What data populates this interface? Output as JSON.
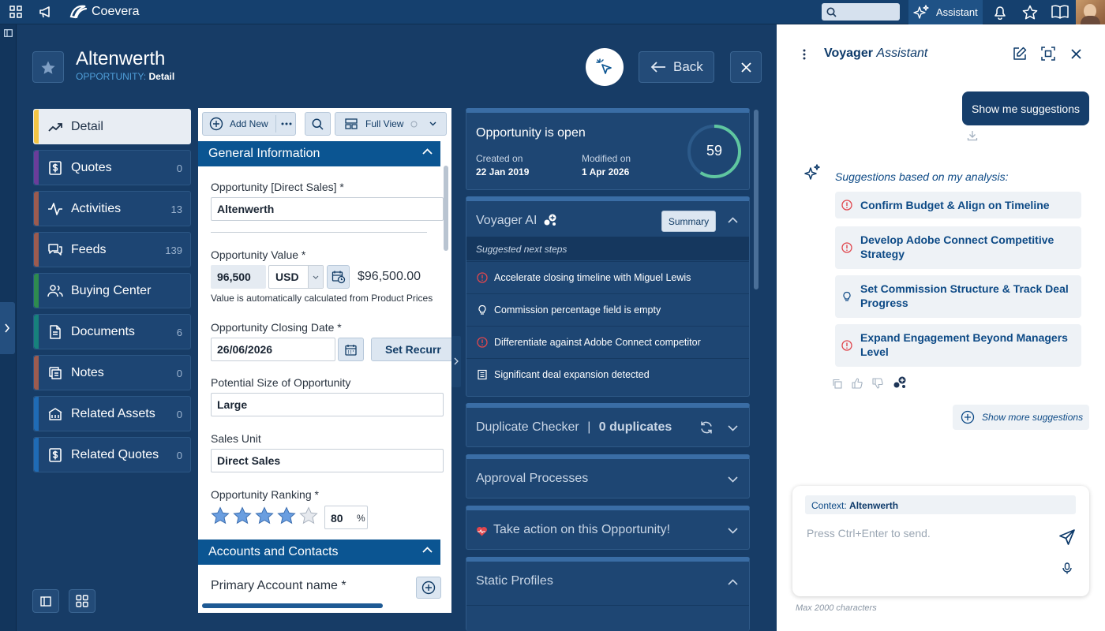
{
  "topbar": {
    "brand": "Coevera",
    "assistant_label": "Assistant",
    "search_placeholder": ""
  },
  "header": {
    "title": "Altenwerth",
    "breadcrumb_entity": "OPPORTUNITY:",
    "breadcrumb_view": "Detail",
    "back_label": "Back"
  },
  "nav": {
    "items": [
      {
        "label": "Detail",
        "count": "",
        "color": "#f3c545"
      },
      {
        "label": "Quotes",
        "count": "0",
        "color": "#6a3d9a"
      },
      {
        "label": "Activities",
        "count": "13",
        "color": "#9c5b4f"
      },
      {
        "label": "Feeds",
        "count": "139",
        "color": "#9c5b4f"
      },
      {
        "label": "Buying Center",
        "count": "",
        "color": "#2e8b4f"
      },
      {
        "label": "Documents",
        "count": "6",
        "color": "#17817c"
      },
      {
        "label": "Notes",
        "count": "0",
        "color": "#9c5b4f"
      },
      {
        "label": "Related Assets",
        "count": "0",
        "color": "#1f6bb5"
      },
      {
        "label": "Related Quotes",
        "count": "0",
        "color": "#1f6bb5"
      }
    ]
  },
  "toolbar": {
    "add_new": "Add New",
    "full_view": "Full View"
  },
  "form": {
    "general_info_title": "General Information",
    "opportunity_label": "Opportunity [Direct Sales] *",
    "opportunity_value": "Altenwerth",
    "value_label": "Opportunity Value *",
    "value_amount": "96,500",
    "value_currency": "USD",
    "value_display": "$96,500.00",
    "value_hint": "Value is automatically calculated from Product Prices",
    "closing_date_label": "Opportunity Closing Date *",
    "closing_date_value": "26/06/2026",
    "set_recurring": "Set Recurr",
    "size_label": "Potential Size of Opportunity",
    "size_value": "Large",
    "sales_unit_label": "Sales Unit",
    "sales_unit_value": "Direct Sales",
    "ranking_label": "Opportunity Ranking *",
    "ranking_stars": 4,
    "ranking_max": 5,
    "ranking_value": "80",
    "ranking_unit": "%",
    "accounts_title": "Accounts and Contacts",
    "primary_account_label": "Primary Account name *"
  },
  "status_panel": {
    "title": "Opportunity is open",
    "created_label": "Created on",
    "created_value": "22 Jan 2019",
    "modified_label": "Modified on",
    "modified_value": "1 Apr 2026",
    "score": "59",
    "score_fraction": 0.59
  },
  "voyager_panel": {
    "title": "Voyager AI",
    "summary_button": "Summary",
    "subheader": "Suggested next steps",
    "rows": [
      {
        "icon": "alert-icon",
        "text": "Accelerate closing timeline with Miguel Lewis"
      },
      {
        "icon": "bulb-icon",
        "text": "Commission percentage field is empty"
      },
      {
        "icon": "alert-icon",
        "text": "Differentiate against Adobe Connect competitor"
      },
      {
        "icon": "document-icon",
        "text": "Significant deal expansion detected"
      }
    ]
  },
  "duplicate_panel": {
    "title": "Duplicate Checker",
    "separator": "|",
    "count": "0 duplicates"
  },
  "approval_panel": {
    "title": "Approval Processes"
  },
  "action_panel": {
    "title": "Take action on this Opportunity!"
  },
  "static_panel": {
    "title": "Static Profiles"
  },
  "assistant": {
    "title_bold": "Voyager",
    "title_italic": "Assistant",
    "user_message": "Show me suggestions",
    "intro": "Suggestions based on my analysis:",
    "suggestions": [
      {
        "icon": "alert-icon",
        "text": "Confirm Budget & Align on Timeline"
      },
      {
        "icon": "alert-icon",
        "text": "Develop Adobe Connect Competitive Strategy"
      },
      {
        "icon": "bulb-icon",
        "text": "Set Commission Structure & Track Deal Progress"
      },
      {
        "icon": "alert-icon",
        "text": "Expand Engagement Beyond Managers Level"
      }
    ],
    "show_more": "Show more suggestions",
    "context_label": "Context:",
    "context_value": "Altenwerth",
    "input_placeholder": "Press Ctrl+Enter to send.",
    "max_chars": "Max 2000 characters"
  },
  "colors": {
    "brand_blue": "#0b5592",
    "alert_red": "#d9363e",
    "score_ring": "#5fc6a0"
  }
}
